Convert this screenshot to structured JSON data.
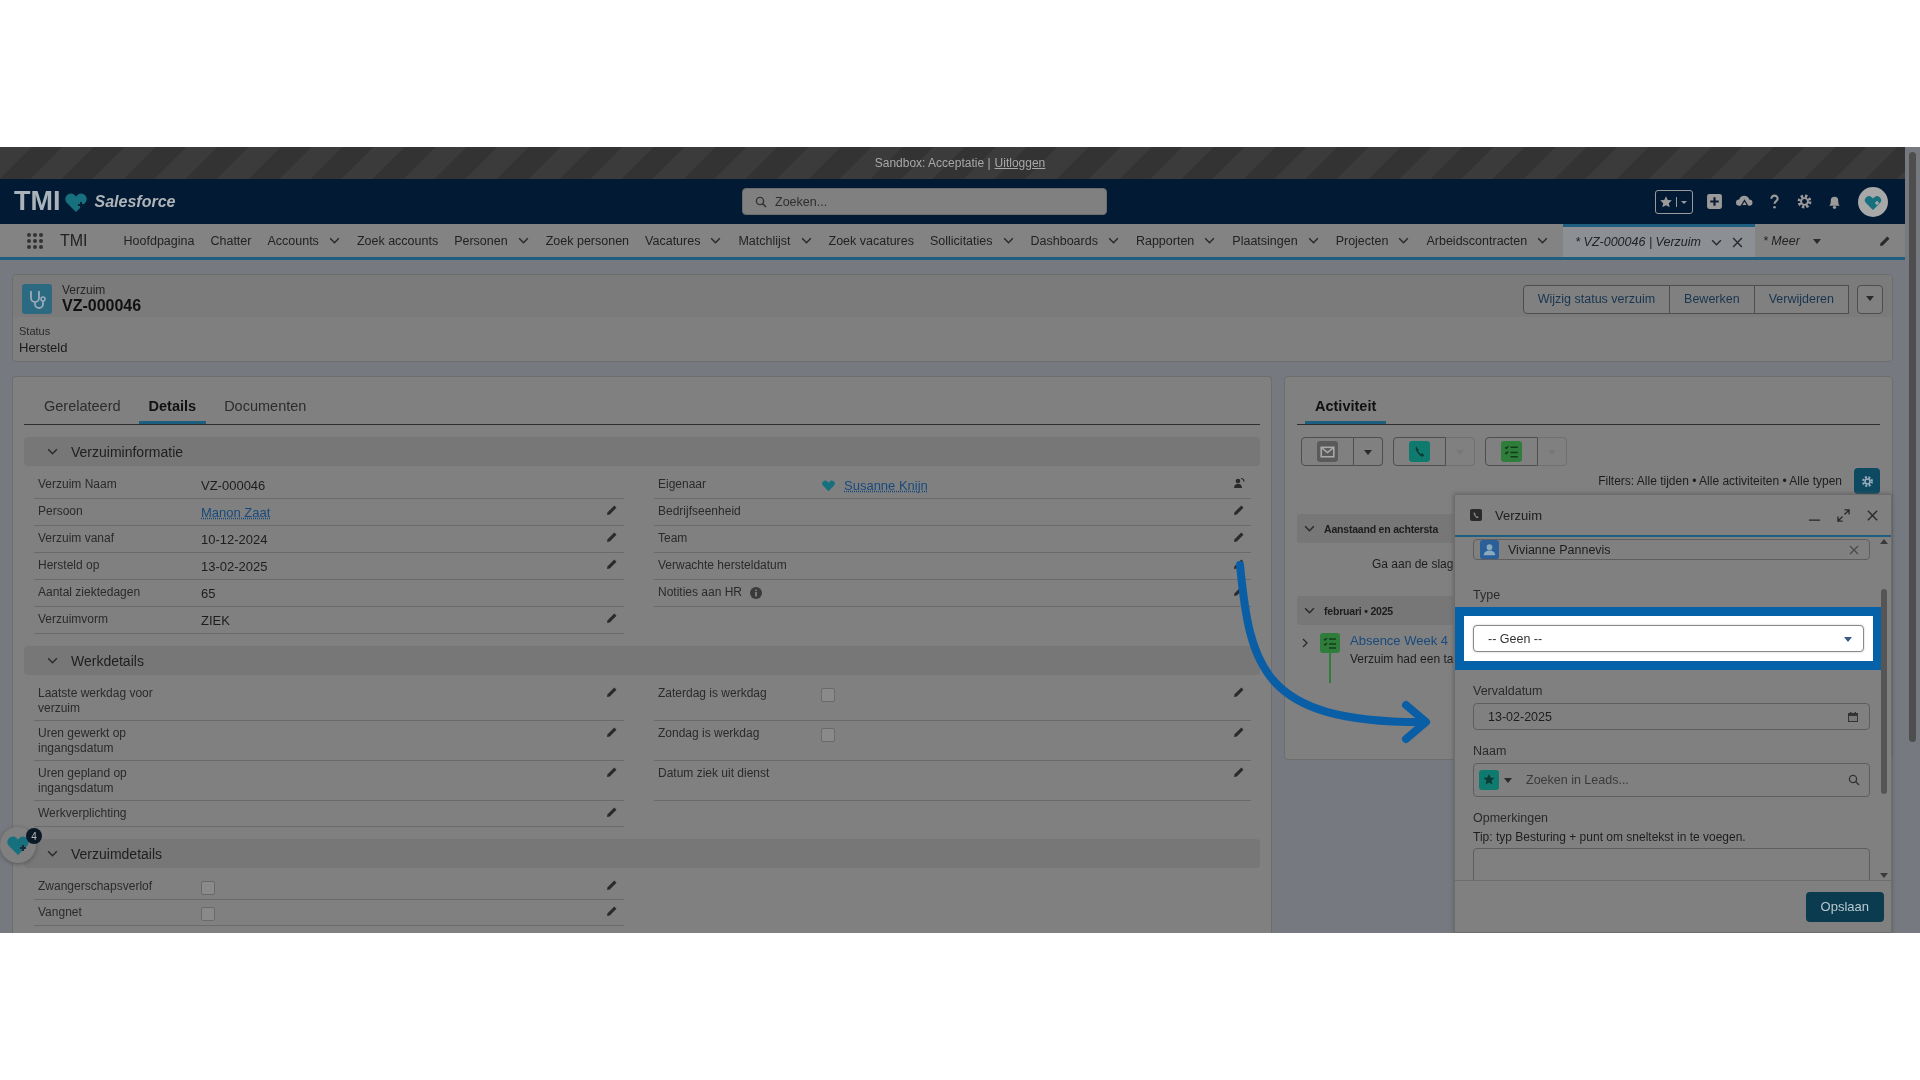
{
  "sandbox_bar": {
    "text": "Sandbox: Acceptatie |",
    "link": "Uitloggen"
  },
  "header": {
    "logo": "TMI",
    "brand": "Salesforce",
    "search_placeholder": "Zoeken..."
  },
  "nav": {
    "app_name": "TMI",
    "items": [
      {
        "label": "Hoofdpagina",
        "dropdown": false,
        "selected": false
      },
      {
        "label": "Chatter",
        "dropdown": false,
        "selected": false
      },
      {
        "label": "Accounts",
        "dropdown": true,
        "selected": false
      },
      {
        "label": "Zoek accounts",
        "dropdown": false,
        "selected": false
      },
      {
        "label": "Personen",
        "dropdown": true,
        "selected": false
      },
      {
        "label": "Zoek personen",
        "dropdown": false,
        "selected": false
      },
      {
        "label": "Vacatures",
        "dropdown": true,
        "selected": false
      },
      {
        "label": "Matchlijst",
        "dropdown": true,
        "selected": false
      },
      {
        "label": "Zoek vacatures",
        "dropdown": false,
        "selected": false
      },
      {
        "label": "Sollicitaties",
        "dropdown": true,
        "selected": false
      },
      {
        "label": "Dashboards",
        "dropdown": true,
        "selected": false
      },
      {
        "label": "Rapporten",
        "dropdown": true,
        "selected": false
      },
      {
        "label": "Plaatsingen",
        "dropdown": true,
        "selected": false
      },
      {
        "label": "Projecten",
        "dropdown": true,
        "selected": false
      },
      {
        "label": "Arbeidscontracten",
        "dropdown": true,
        "selected": false
      },
      {
        "label": "* VZ-000046 | Verzuim",
        "dropdown": true,
        "selected": true,
        "closable": true
      }
    ],
    "more": "* Meer"
  },
  "record": {
    "object": "Verzuim",
    "name": "VZ-000046",
    "status_label": "Status",
    "status": "Hersteld",
    "actions": [
      "Wijzig status verzuim",
      "Bewerken",
      "Verwijderen"
    ]
  },
  "detail_tabs": [
    {
      "label": "Gerelateerd",
      "selected": false
    },
    {
      "label": "Details",
      "selected": true
    },
    {
      "label": "Documenten",
      "selected": false
    }
  ],
  "sections": [
    {
      "title": "Verzuiminformatie",
      "expanded": true,
      "rows": [
        {
          "left": {
            "label": "Verzuim Naam",
            "kind": "text",
            "value": "VZ-000046",
            "editable": false
          },
          "right": {
            "label": "Eigenaar",
            "kind": "user",
            "value": "Susanne Knijn",
            "editable": false,
            "reassignable": true
          }
        },
        {
          "left": {
            "label": "Persoon",
            "kind": "link",
            "value": "Manon Zaat",
            "editable": true
          },
          "right": {
            "label": "Bedrijfseenheid",
            "kind": "empty",
            "editable": true
          }
        },
        {
          "left": {
            "label": "Verzuim vanaf",
            "kind": "text",
            "value": "10-12-2024",
            "editable": true
          },
          "right": {
            "label": "Team",
            "kind": "empty",
            "editable": true
          }
        },
        {
          "left": {
            "label": "Hersteld op",
            "kind": "text",
            "value": "13-02-2025",
            "editable": true
          },
          "right": {
            "label": "Verwachte hersteldatum",
            "kind": "empty",
            "editable": true
          }
        },
        {
          "left": {
            "label": "Aantal ziektedagen",
            "kind": "text",
            "value": "65",
            "editable": false
          },
          "right": {
            "label": "Notities aan HR",
            "kind": "empty",
            "info": true,
            "editable": true
          }
        },
        {
          "left": {
            "label": "Verzuimvorm",
            "kind": "text",
            "value": "ZIEK",
            "editable": true
          }
        }
      ]
    },
    {
      "title": "Werkdetails",
      "expanded": true,
      "rows": [
        {
          "left": {
            "label": "Laatste werkdag voor verzuim",
            "kind": "empty",
            "editable": true
          },
          "right": {
            "label": "Zaterdag is werkdag",
            "kind": "checkbox",
            "checked": false,
            "editable": true
          }
        },
        {
          "left": {
            "label": "Uren gewerkt op ingangsdatum",
            "kind": "empty",
            "editable": true
          },
          "right": {
            "label": "Zondag is werkdag",
            "kind": "checkbox",
            "checked": false,
            "editable": true
          }
        },
        {
          "left": {
            "label": "Uren gepland op ingangsdatum",
            "kind": "empty",
            "editable": true
          },
          "right": {
            "label": "Datum ziek uit dienst",
            "kind": "empty",
            "editable": true
          }
        },
        {
          "left": {
            "label": "Werkverplichting",
            "kind": "empty",
            "editable": true
          }
        }
      ]
    },
    {
      "title": "Verzuimdetails",
      "expanded": true,
      "rows": [
        {
          "left": {
            "label": "Zwangerschapsverlof",
            "kind": "checkbox",
            "checked": false,
            "editable": true
          }
        },
        {
          "left": {
            "label": "Vangnet",
            "kind": "checkbox",
            "checked": false,
            "editable": true
          }
        }
      ]
    }
  ],
  "assistant_badge": "4",
  "activity": {
    "title": "Activiteit",
    "composer": [
      {
        "kind": "email",
        "disabled": false
      },
      {
        "kind": "call",
        "disabled": true
      },
      {
        "kind": "task",
        "disabled": true
      }
    ],
    "filters": "Filters: Alle tijden • Alle activiteiten • Alle typen",
    "groups": [
      {
        "title": "Aanstaand en achtersta",
        "expanded": true,
        "empty_text": "Ga aan de slag"
      },
      {
        "title": "februari • 2025",
        "expanded": true,
        "items": [
          {
            "title": "Absence Week 4",
            "subtitle": "Verzuim had een ta",
            "expanded": false
          }
        ]
      }
    ]
  },
  "panel": {
    "title": "Verzuim",
    "fields": [
      {
        "kind": "contact",
        "value": "Vivianne Pannevis"
      },
      {
        "kind": "select",
        "label": "Type",
        "value": "-- Geen --",
        "highlighted": true
      },
      {
        "kind": "date",
        "label": "Vervaldatum",
        "value": "13-02-2025",
        "highlighted": false
      },
      {
        "kind": "lookup",
        "label": "Naam",
        "placeholder": "Zoeken in Leads...",
        "highlighted": false
      },
      {
        "kind": "textarea",
        "label": "Opmerkingen",
        "hint": "Tip: typ Besturing + punt om sneltekst in te voegen.",
        "highlighted": false
      }
    ],
    "save": "Opslaan"
  }
}
